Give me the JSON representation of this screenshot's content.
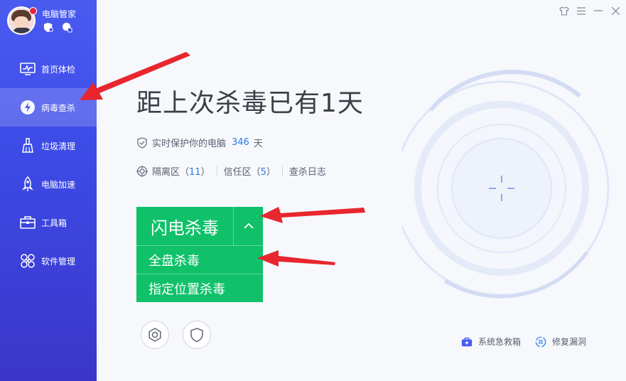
{
  "brand": {
    "name": "电脑管家",
    "avatar": "user-avatar",
    "badges": [
      "shield-badge-icon",
      "chat-badge-icon"
    ]
  },
  "sidebar": {
    "items": [
      {
        "label": "首页体检",
        "icon": "monitor-icon",
        "active": false
      },
      {
        "label": "病毒查杀",
        "icon": "lightning-icon",
        "active": true
      },
      {
        "label": "垃圾清理",
        "icon": "broom-icon",
        "active": false
      },
      {
        "label": "电脑加速",
        "icon": "rocket-icon",
        "active": false
      },
      {
        "label": "工具箱",
        "icon": "toolbox-icon",
        "active": false
      },
      {
        "label": "软件管理",
        "icon": "apps-icon",
        "active": false
      }
    ]
  },
  "window_controls": [
    "skin-icon",
    "menu-icon",
    "minimize-icon",
    "close-icon"
  ],
  "main": {
    "headline": "距上次杀毒已有1天",
    "protect": {
      "text": "实时保护你的电脑",
      "days": "346",
      "unit": "天"
    },
    "links": {
      "quarantine": {
        "label": "隔离区（",
        "count": "11",
        "close": "）"
      },
      "trust": {
        "label": "信任区（",
        "count": "5",
        "close": "）"
      },
      "log": "查杀日志"
    },
    "scan": {
      "primary": "闪电杀毒",
      "options": [
        "全盘杀毒",
        "指定位置杀毒"
      ]
    },
    "tools": [
      {
        "label": "系统急救箱",
        "icon": "first-aid-kit-icon"
      },
      {
        "label": "修复漏洞",
        "icon": "patch-icon"
      }
    ]
  },
  "colors": {
    "sidebar": "#4a5bf0",
    "accent_green": "#10c16a",
    "link_blue": "#2a7de1",
    "arrow_red": "#e8262e"
  }
}
